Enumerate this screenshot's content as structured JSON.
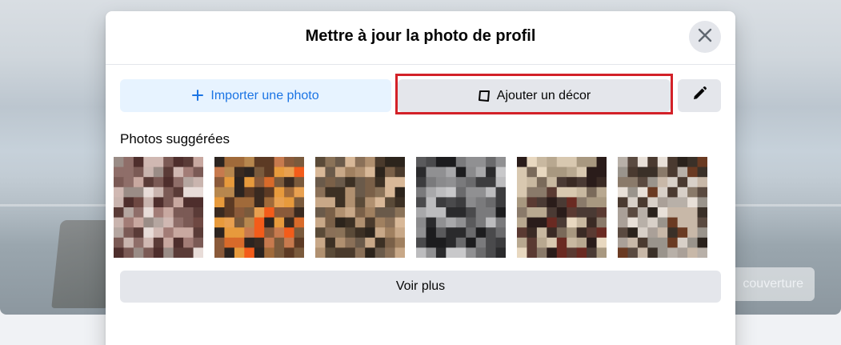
{
  "background": {
    "cover_button_label": "couverture"
  },
  "modal": {
    "title": "Mettre à jour la photo de profil",
    "close_icon": "close-icon",
    "buttons": {
      "import_label": "Importer une photo",
      "import_icon": "plus-icon",
      "decor_label": "Ajouter un décor",
      "decor_icon": "frame-icon",
      "edit_icon": "pencil-icon"
    },
    "highlight_color": "#d32128",
    "suggested_label": "Photos suggérées",
    "photos": [
      {
        "colors": [
          "#9a8c86",
          "#b5a6a0",
          "#7b5a55",
          "#c9b4ae",
          "#e8dcd8",
          "#5a3b37",
          "#a27c76",
          "#d0b8b2",
          "#4e2e2c",
          "#8f6e69",
          "#c8a8a0",
          "#6e4842"
        ]
      },
      {
        "colors": [
          "#c77a4e",
          "#8a5a3a",
          "#e79a3c",
          "#f35c1a",
          "#5c3a24",
          "#b7874e",
          "#e8a050",
          "#d86a2a",
          "#3a2a20",
          "#7a5a3c",
          "#a06a3a",
          "#2c2420"
        ]
      },
      {
        "colors": [
          "#6a5a4a",
          "#c8a888",
          "#8a7058",
          "#d8b898",
          "#4a3a2c",
          "#b09070",
          "#7a6048",
          "#a08060",
          "#2c241c",
          "#5a4a38",
          "#3c3024",
          "#8a7258"
        ]
      },
      {
        "colors": [
          "#4a4a4c",
          "#8a8a8c",
          "#1c1c1e",
          "#a8a8aa",
          "#6a6a6c",
          "#c8c8ca",
          "#2a2a2c",
          "#909092",
          "#5a5a5c",
          "#bcbcbe",
          "#3c3c3e",
          "#7a7a7c"
        ]
      },
      {
        "colors": [
          "#b8a890",
          "#e8d8c0",
          "#7a6a5a",
          "#3a2a24",
          "#c8b8a0",
          "#5a3a32",
          "#2a1c1a",
          "#8a7a6a",
          "#6a2a22",
          "#d8c8b0",
          "#4a3a34",
          "#a89880"
        ]
      },
      {
        "colors": [
          "#9a948c",
          "#d8d0c8",
          "#5a4a40",
          "#2a221c",
          "#b8b0a8",
          "#6a3a22",
          "#e8e0d8",
          "#3a3028",
          "#8a7a6a",
          "#c8b8a8",
          "#4a3a30",
          "#aaa098"
        ]
      }
    ],
    "more_label": "Voir plus"
  }
}
